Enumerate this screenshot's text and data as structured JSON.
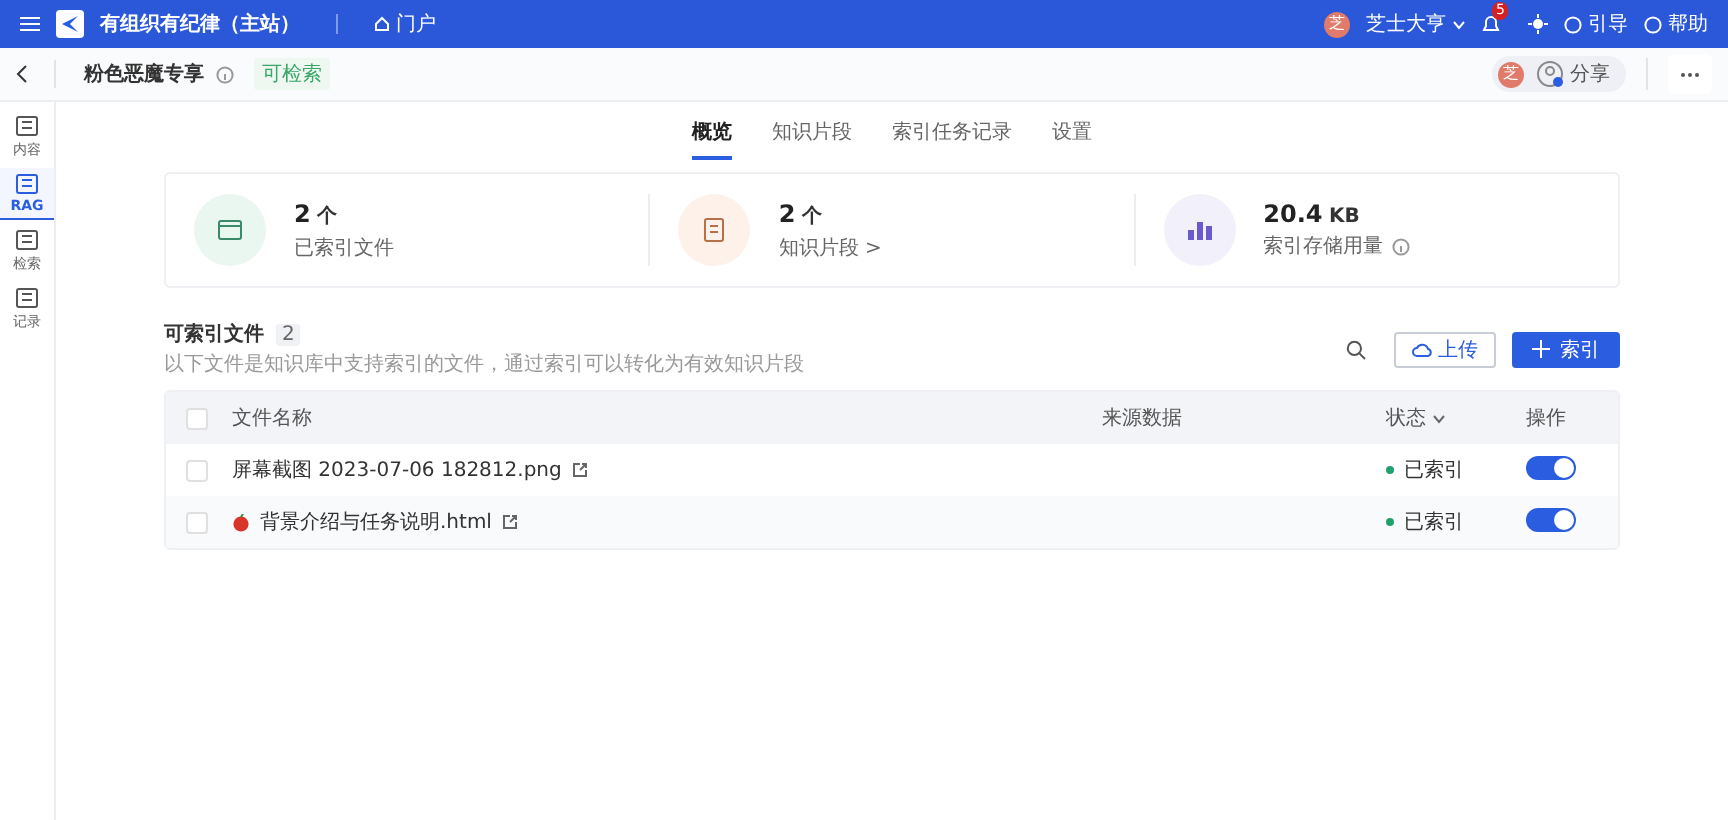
{
  "topbar": {
    "title": "有组织有纪律（主站）",
    "portal": "门户",
    "user_avatar": "芝",
    "user": "芝士大亨",
    "notifications": "5",
    "guide": "引导",
    "help": "帮助"
  },
  "header": {
    "title": "粉色恶魔专享",
    "tag": "可检索",
    "avatar": "芝",
    "share": "分享"
  },
  "sidebar": {
    "items": [
      {
        "label": "内容",
        "selected": false
      },
      {
        "label": "RAG",
        "selected": true
      },
      {
        "label": "检索",
        "selected": false
      },
      {
        "label": "记录",
        "selected": false
      }
    ]
  },
  "tabs": [
    {
      "label": "概览",
      "selected": true
    },
    {
      "label": "知识片段",
      "selected": false
    },
    {
      "label": "索引任务记录",
      "selected": false
    },
    {
      "label": "设置",
      "selected": false
    }
  ],
  "stats": [
    {
      "kind": "files",
      "value": "2",
      "unit": "个",
      "label": "已索引文件"
    },
    {
      "kind": "chunks",
      "value": "2",
      "unit": "个",
      "label": "知识片段 >"
    },
    {
      "kind": "storage",
      "value": "20.4",
      "unit": "KB",
      "label": "索引存储用量"
    }
  ],
  "files": {
    "title": "可索引文件",
    "count": "2",
    "description": "以下文件是知识库中支持索引的文件，通过索引可以转化为有效知识片段",
    "upload": "上传",
    "index": "索引",
    "columns": [
      "文件名称",
      "来源数据",
      "状态",
      "操作"
    ],
    "select_all": false,
    "rows": [
      {
        "kind": "image",
        "name": "屏幕截图 2023-07-06 182812.png",
        "status": "已索引",
        "color": "#22a06b",
        "checked": false,
        "on": true
      },
      {
        "kind": "html",
        "name": "背景介绍与任务说明.html",
        "status": "已索引",
        "color": "#22a06b",
        "checked": false,
        "on": true
      }
    ]
  }
}
